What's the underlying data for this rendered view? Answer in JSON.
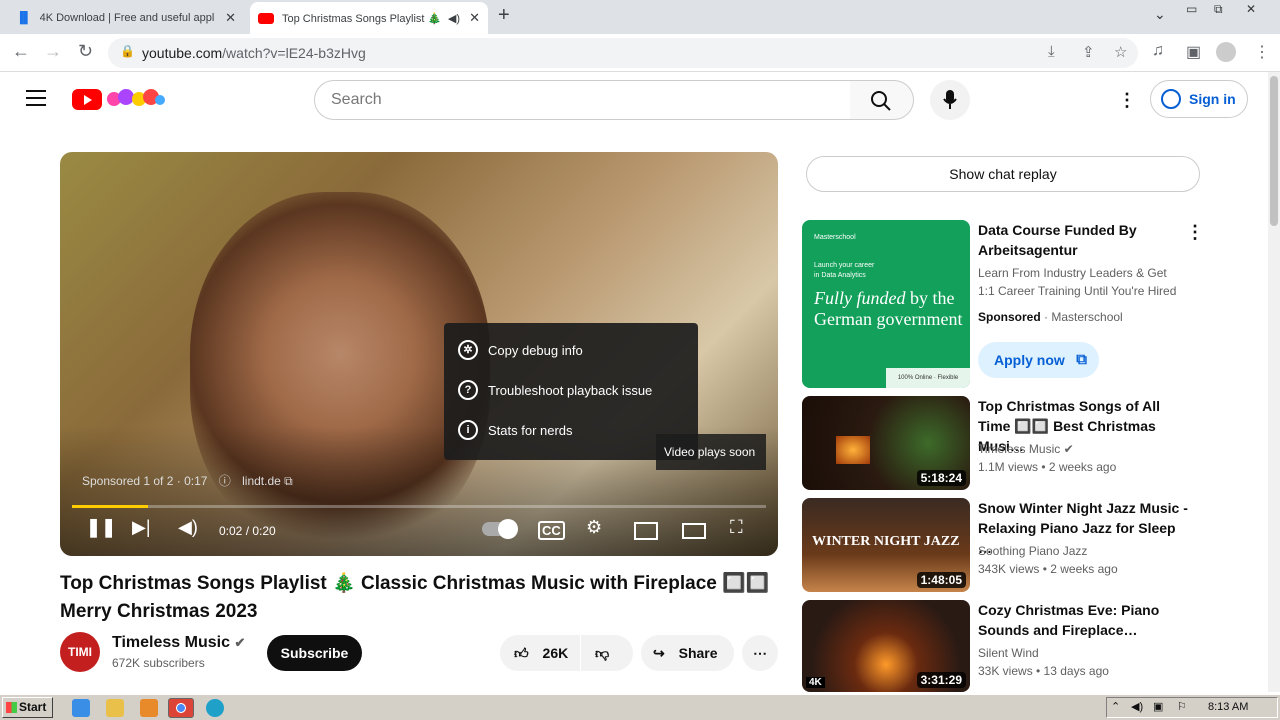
{
  "browser": {
    "tabs": [
      {
        "title": "4K Download | Free and useful applic",
        "close": "✕"
      },
      {
        "title": "Top Christmas Songs Playlist 🎄",
        "close": "✕"
      }
    ],
    "new_tab": "+",
    "url_host": "youtube.com",
    "url_path": "/watch?v=lE24-b3zHvg"
  },
  "header": {
    "search_placeholder": "Search",
    "signin_label": "Sign in"
  },
  "player": {
    "sponsored_text": "Sponsored 1 of 2 · 0:17",
    "advertiser_link": "lindt.de",
    "time": "0:02 / 0:20",
    "video_soon": "Video plays soon",
    "ad_progress": 0.11,
    "context_menu": [
      {
        "icon": "bug-icon",
        "label": "Copy debug info"
      },
      {
        "icon": "help-icon",
        "label": "Troubleshoot playback issue"
      },
      {
        "icon": "info-icon",
        "label": "Stats for nerds"
      }
    ]
  },
  "video": {
    "title": "Top Christmas Songs Playlist 🎄 Classic Christmas Music with Fireplace 🔲🔲 Merry Christmas 2023",
    "channel": "Timeless Music",
    "channel_initials": "TIMI",
    "subscribers": "672K subscribers",
    "subscribe_label": "Subscribe",
    "likes": "26K",
    "share_label": "Share"
  },
  "sidebar": {
    "chat_replay": "Show chat replay",
    "ad": {
      "title": "Data Course Funded By Arbeitsagentur",
      "desc1": "Learn From Industry Leaders & Get",
      "desc2": "1:1 Career Training Until You're Hired",
      "sponsored": "Sponsored",
      "advertiser": "· Masterschool",
      "cta": "Apply now",
      "thumb_brand": "Masterschool",
      "thumb_line1": "Launch your career",
      "thumb_line2": "in Data Analytics",
      "thumb_big_italic": "Fully funded",
      "thumb_big_rest": " by the German government",
      "thumb_corner": "100% Online · Flexible"
    },
    "videos": [
      {
        "title": "Top Christmas Songs of All Time 🔲🔲 Best Christmas Musi…",
        "channel": "Timeless Music",
        "meta": "1.1M views  • 2 weeks ago",
        "duration": "5:18:24"
      },
      {
        "title": "Snow Winter Night Jazz Music - Relaxing Piano Jazz for Sleep …",
        "channel": "Soothing Piano Jazz",
        "meta": "343K views  • 2 weeks ago",
        "duration": "1:48:05",
        "thumb_text": "WINTER NIGHT JAZZ"
      },
      {
        "title": "Cozy Christmas Eve: Piano Sounds and Fireplace…",
        "channel": "Silent Wind",
        "meta": "33K views  • 13 days ago",
        "duration": "3:31:29",
        "badge": "4K"
      }
    ]
  },
  "taskbar": {
    "start": "Start",
    "clock": "8:13 AM"
  },
  "colors": {
    "accent": "#065fd4",
    "youtube_red": "#ff0000",
    "ad_green": "#12a05a"
  }
}
